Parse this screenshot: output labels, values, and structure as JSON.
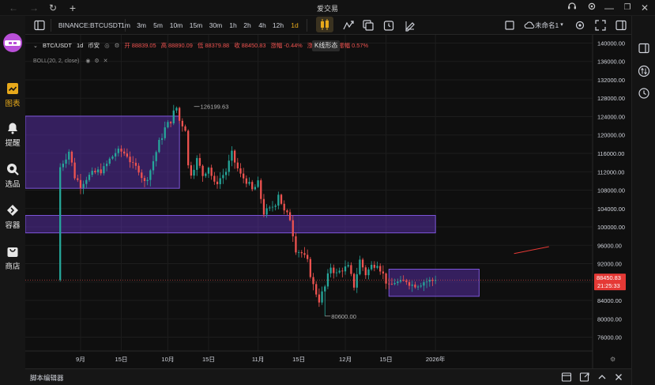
{
  "window": {
    "title": "爱交易"
  },
  "nav": {
    "items": [
      {
        "label": "图表",
        "icon": "chart-icon"
      },
      {
        "label": "提醒",
        "icon": "bell-icon"
      },
      {
        "label": "选品",
        "icon": "search-icon"
      },
      {
        "label": "容器",
        "icon": "container-icon"
      },
      {
        "label": "商店",
        "icon": "store-icon"
      }
    ]
  },
  "toolbar": {
    "symbol": "BINANCE:BTCUSDT",
    "intervals": [
      "1m",
      "3m",
      "5m",
      "10m",
      "15m",
      "30m",
      "1h",
      "2h",
      "4h",
      "12h",
      "1d"
    ],
    "active_interval": "1d",
    "layout_name": "未命名1",
    "tooltip": "K线形态"
  },
  "legend": {
    "pair": "BTC/USDT",
    "interval": "1d",
    "exchange": "币安",
    "open_label": "开",
    "open": "88839.05",
    "high_label": "高",
    "high": "88890.09",
    "low_label": "低",
    "low": "88379.88",
    "close_label": "收",
    "close": "88450.83",
    "change_label": "涨幅",
    "change": "-0.44%",
    "trail_label": "涨",
    "amplitude_label": "振幅",
    "amplitude": "0.57%"
  },
  "indicator": {
    "label": "BOLL(20, 2, close)"
  },
  "chart_data": {
    "type": "candlestick",
    "y_ticks": [
      "140000.00",
      "136000.00",
      "132000.00",
      "128000.00",
      "124000.00",
      "120000.00",
      "116000.00",
      "112000.00",
      "108000.00",
      "104000.00",
      "100000.00",
      "96000.00",
      "92000.00",
      "88000.00",
      "84000.00",
      "80000.00",
      "76000.00"
    ],
    "ylim": [
      73000,
      141800
    ],
    "x_ticks": [
      {
        "label": "9月",
        "day": 7
      },
      {
        "label": "15日",
        "day": 21
      },
      {
        "label": "10月",
        "day": 37
      },
      {
        "label": "15日",
        "day": 51
      },
      {
        "label": "11月",
        "day": 68
      },
      {
        "label": "15日",
        "day": 82
      },
      {
        "label": "12月",
        "day": 98
      },
      {
        "label": "15日",
        "day": 112
      },
      {
        "label": "2026年",
        "day": 129
      }
    ],
    "day_span": [
      -12,
      183
    ],
    "annotations": [
      {
        "text": "126199.63",
        "day": 46,
        "price": 126199.63,
        "kind": "high"
      },
      {
        "text": "80600.00",
        "day": 91,
        "price": 80600,
        "kind": "low"
      }
    ],
    "current_price": {
      "value": "88450.83",
      "countdown": "21:25:33",
      "price": 88450.83
    },
    "color_up": "#26a69a",
    "color_down": "#ef5350",
    "zone_color": "#5b2fae",
    "zones": [
      {
        "day_start": -12,
        "day_end": 41,
        "price_low": 108400,
        "price_high": 124100
      },
      {
        "day_start": -12,
        "day_end": 129,
        "price_low": 98700,
        "price_high": 102500
      },
      {
        "day_start": 113,
        "day_end": 144,
        "price_low": 84900,
        "price_high": 90800
      }
    ],
    "trend_line": {
      "day1": 156,
      "price1": 94200,
      "day2": 168,
      "price2": 95700
    },
    "ohlc_keypoints": [
      [
        0,
        113000
      ],
      [
        3,
        116500
      ],
      [
        5,
        111000
      ],
      [
        7,
        109200
      ],
      [
        9,
        110700
      ],
      [
        12,
        111800
      ],
      [
        15,
        112600
      ],
      [
        17,
        114600
      ],
      [
        19,
        116200
      ],
      [
        21,
        116400
      ],
      [
        23,
        115700
      ],
      [
        25,
        113200
      ],
      [
        27,
        112600
      ],
      [
        29,
        109600
      ],
      [
        31,
        112400
      ],
      [
        34,
        118300
      ],
      [
        36,
        121400
      ],
      [
        38,
        123200
      ],
      [
        39,
        124800
      ],
      [
        40,
        125900
      ],
      [
        41,
        123100
      ],
      [
        43,
        121500
      ],
      [
        44,
        113200
      ],
      [
        45,
        111800
      ],
      [
        47,
        114600
      ],
      [
        49,
        111300
      ],
      [
        51,
        113200
      ],
      [
        53,
        109200
      ],
      [
        55,
        110600
      ],
      [
        57,
        112100
      ],
      [
        59,
        115800
      ],
      [
        60,
        114100
      ],
      [
        62,
        111200
      ],
      [
        64,
        110100
      ],
      [
        66,
        107900
      ],
      [
        68,
        109400
      ],
      [
        70,
        103100
      ],
      [
        72,
        103700
      ],
      [
        74,
        105300
      ],
      [
        75,
        107400
      ],
      [
        77,
        103200
      ],
      [
        79,
        101900
      ],
      [
        81,
        95200
      ],
      [
        83,
        94300
      ],
      [
        85,
        92300
      ],
      [
        87,
        87200
      ],
      [
        89,
        84100
      ],
      [
        91,
        86900
      ],
      [
        93,
        91400
      ],
      [
        95,
        89700
      ],
      [
        97,
        90900
      ],
      [
        99,
        91100
      ],
      [
        101,
        87200
      ],
      [
        103,
        92700
      ],
      [
        105,
        89800
      ],
      [
        107,
        91500
      ],
      [
        109,
        92300
      ],
      [
        111,
        89600
      ],
      [
        113,
        86800
      ],
      [
        115,
        88100
      ],
      [
        117,
        87700
      ],
      [
        119,
        88400
      ],
      [
        121,
        87400
      ],
      [
        123,
        87600
      ],
      [
        125,
        88100
      ],
      [
        127,
        88200
      ],
      [
        129,
        88450
      ]
    ]
  }
}
